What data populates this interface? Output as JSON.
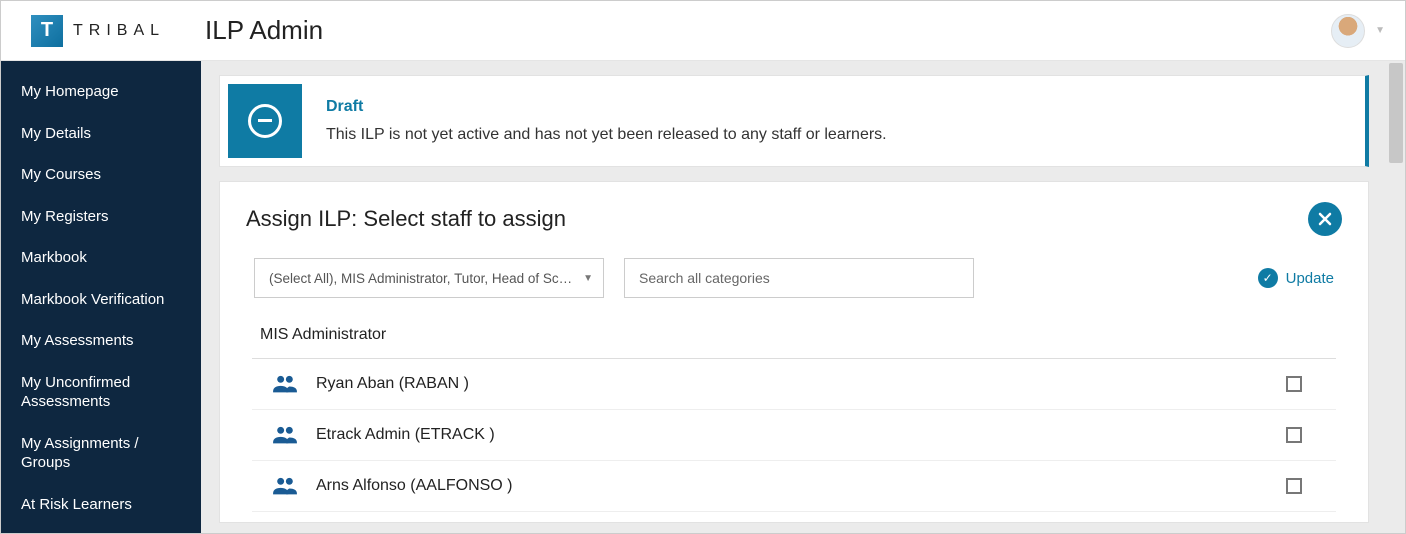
{
  "brand": {
    "logo_letter": "T",
    "logo_text": "TRIBAL"
  },
  "page_title": "ILP Admin",
  "sidebar": {
    "items": [
      "My Homepage",
      "My Details",
      "My Courses",
      "My Registers",
      "Markbook",
      "Markbook Verification",
      "My Assessments",
      "My Unconfirmed Assessments",
      "My Assignments / Groups",
      "At Risk Learners"
    ]
  },
  "status": {
    "title": "Draft",
    "description": "This ILP is not yet active and has not yet been released to any staff or learners."
  },
  "assign": {
    "title": "Assign ILP: Select staff to assign",
    "filter_select_text": "(Select All), MIS Administrator, Tutor, Head of Sc…",
    "search_placeholder": "Search all categories",
    "update_label": "Update",
    "group_title": "MIS Administrator",
    "staff": [
      {
        "name": "Ryan Aban (RABAN )"
      },
      {
        "name": "Etrack Admin (ETRACK )"
      },
      {
        "name": "Arns Alfonso (AALFONSO )"
      }
    ]
  }
}
